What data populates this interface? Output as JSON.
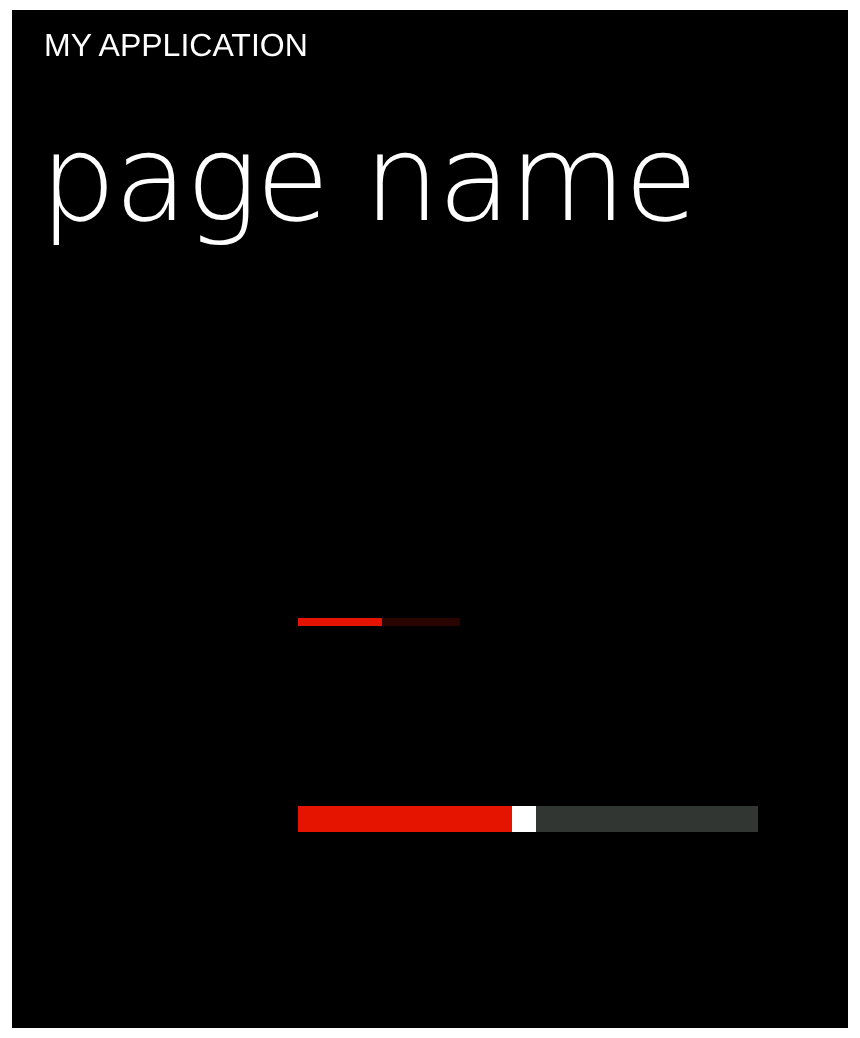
{
  "app_title": "MY APPLICATION",
  "page_title": "page name",
  "progress_bar": {
    "level": 0.52
  },
  "slider": {
    "level": 0.49
  }
}
